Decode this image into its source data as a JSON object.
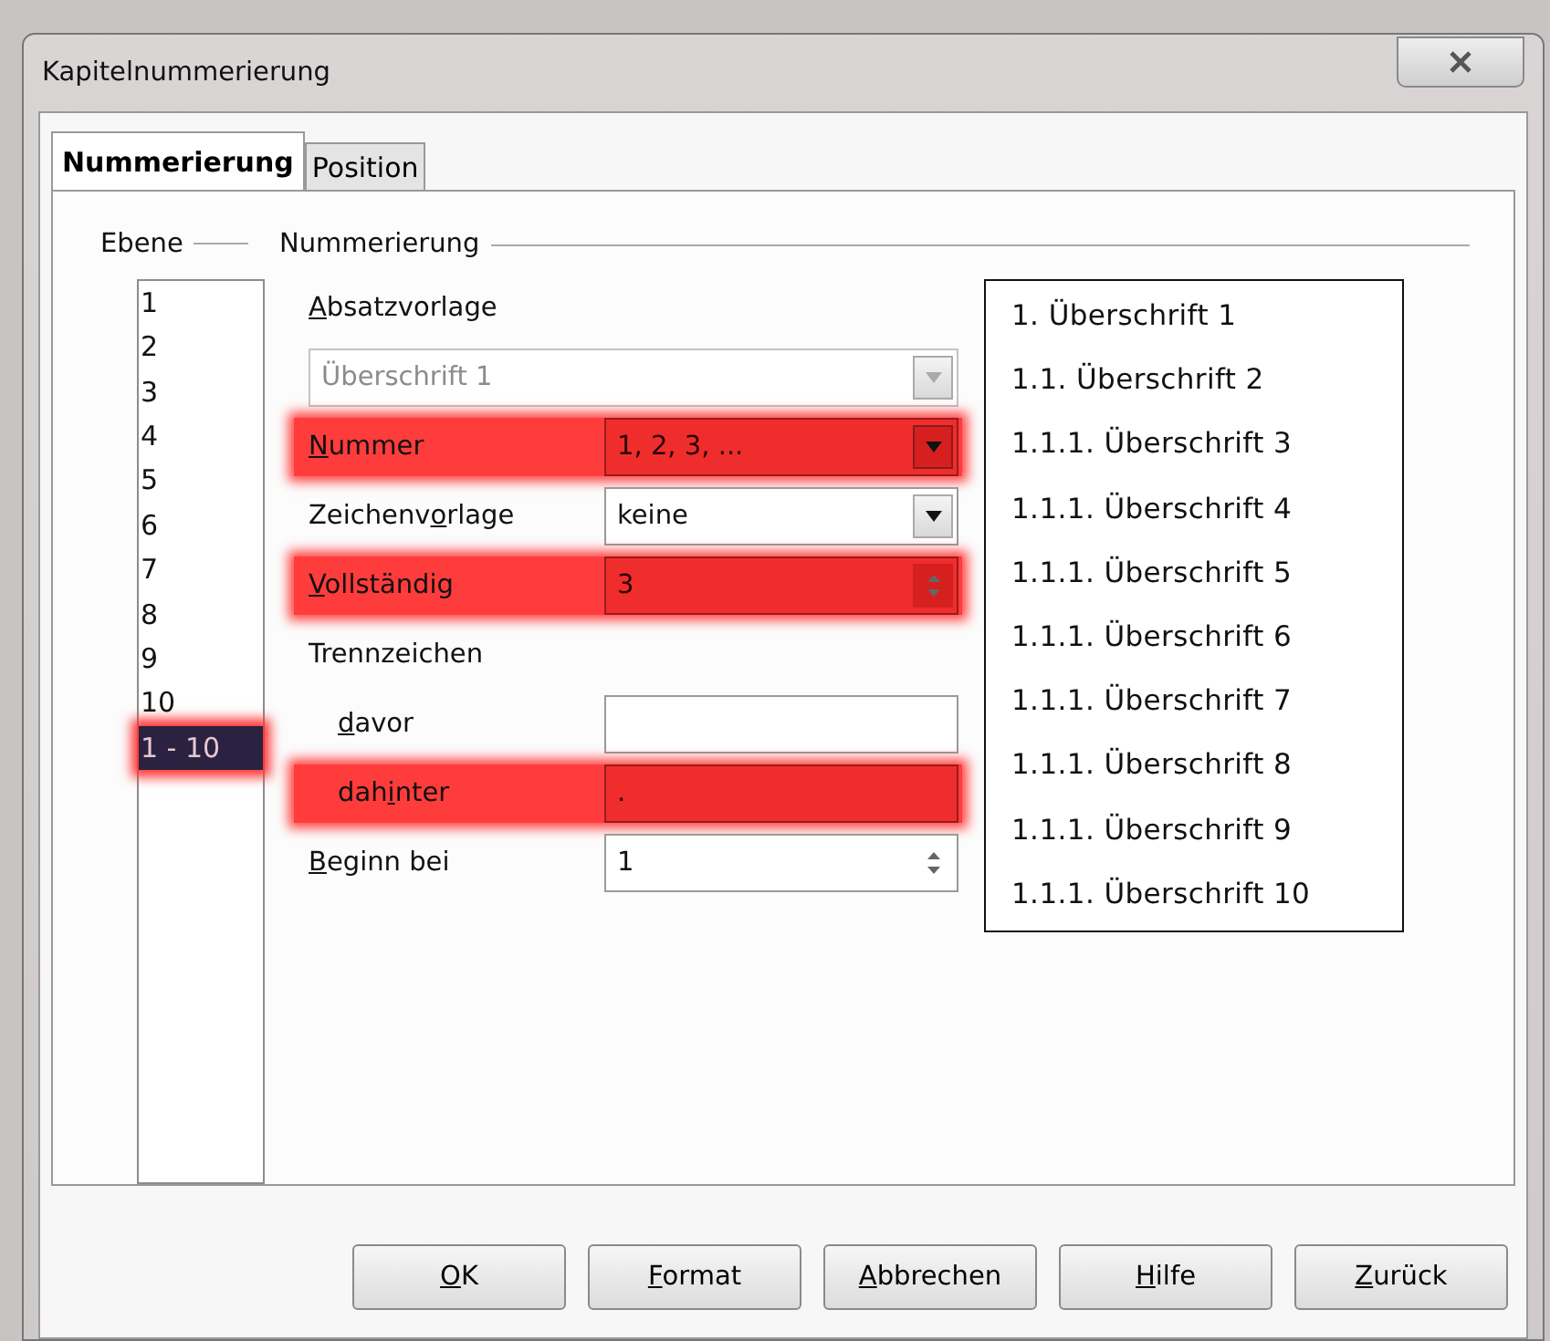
{
  "window": {
    "title": "Kapitelnummerierung"
  },
  "tabs": [
    {
      "label": "Nummerierung",
      "selected": true
    },
    {
      "label": "Position",
      "selected": false
    }
  ],
  "levels": {
    "legend": "Ebene",
    "items": [
      {
        "label": "1",
        "selected": false,
        "highlighted": false
      },
      {
        "label": "2",
        "selected": false,
        "highlighted": false
      },
      {
        "label": "3",
        "selected": false,
        "highlighted": false
      },
      {
        "label": "4",
        "selected": false,
        "highlighted": false
      },
      {
        "label": "5",
        "selected": false,
        "highlighted": false
      },
      {
        "label": "6",
        "selected": false,
        "highlighted": false
      },
      {
        "label": "7",
        "selected": false,
        "highlighted": false
      },
      {
        "label": "8",
        "selected": false,
        "highlighted": false
      },
      {
        "label": "9",
        "selected": false,
        "highlighted": false
      },
      {
        "label": "10",
        "selected": false,
        "highlighted": false
      },
      {
        "label": "1 - 10",
        "selected": true,
        "highlighted": true
      }
    ]
  },
  "numbering": {
    "legend": "Nummerierung",
    "rows": [
      {
        "kind": "heading",
        "label": {
          "key": "A",
          "after": "bsatzvorlage"
        }
      },
      {
        "kind": "combo",
        "value": "Überschrift 1",
        "disabled": true,
        "highlighted": false
      },
      {
        "kind": "combo",
        "label": {
          "key": "N",
          "after": "ummer"
        },
        "value": "1, 2, 3, ...",
        "disabled": false,
        "highlighted": true
      },
      {
        "kind": "combo",
        "label": {
          "before": "Zeichenv",
          "key": "o",
          "after": "rlage"
        },
        "value": "keine",
        "disabled": false,
        "highlighted": false
      },
      {
        "kind": "spin",
        "label": {
          "key": "V",
          "after": "ollständig"
        },
        "value": "3",
        "disabled": false,
        "highlighted": true
      },
      {
        "kind": "heading",
        "label": {
          "before": "Trennzeichen"
        },
        "children": [
          {
            "kind": "text",
            "label": {
              "key": "d",
              "after": "avor"
            },
            "disabled": false,
            "highlighted": false
          },
          {
            "kind": "text",
            "label": {
              "before": "dah",
              "key": "i",
              "after": "nter"
            },
            "value": ".",
            "disabled": false,
            "highlighted": true
          }
        ]
      },
      {
        "kind": "spin",
        "label": {
          "key": "B",
          "after": "eginn bei"
        },
        "value": "1",
        "disabled": false,
        "highlighted": false
      }
    ]
  },
  "preview": [
    "1. Überschrift 1",
    "1.1. Überschrift 2",
    "1.1.1. Überschrift 3",
    "1.1.1. Überschrift 4",
    "1.1.1. Überschrift 5",
    "1.1.1. Überschrift 6",
    "1.1.1. Überschrift 7",
    "1.1.1. Überschrift 8",
    "1.1.1. Überschrift 9",
    "1.1.1. Überschrift 10"
  ],
  "buttons": [
    {
      "label": {
        "key": "O",
        "after": "K"
      }
    },
    {
      "label": {
        "key": "F",
        "after": "ormat"
      }
    },
    {
      "label": {
        "key": "A",
        "after": "bbrechen"
      }
    },
    {
      "label": {
        "key": "H",
        "after": "ilfe"
      }
    },
    {
      "label": {
        "key": "Z",
        "after": "urück"
      }
    }
  ]
}
